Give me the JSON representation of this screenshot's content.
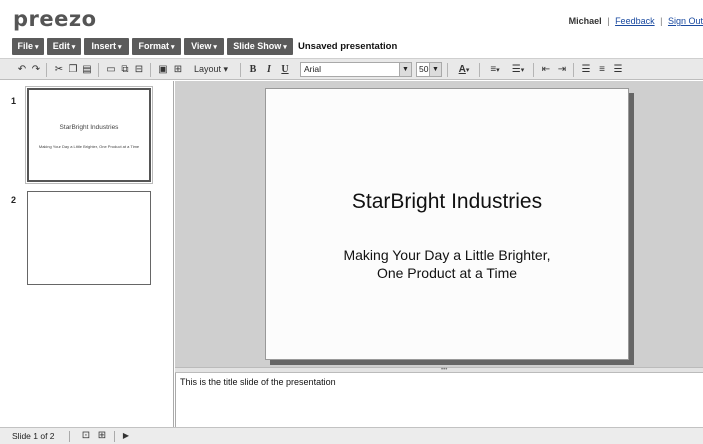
{
  "app": {
    "logo": "preezo"
  },
  "user": {
    "name": "Michael",
    "feedback": "Feedback",
    "signout": "Sign Out",
    "separator": "|"
  },
  "menu": {
    "items": [
      {
        "label": "File"
      },
      {
        "label": "Edit"
      },
      {
        "label": "Insert"
      },
      {
        "label": "Format"
      },
      {
        "label": "View"
      },
      {
        "label": "Slide Show"
      }
    ],
    "doc_title": "Unsaved presentation"
  },
  "toolbar": {
    "layout_label": "Layout",
    "bold": "B",
    "italic": "I",
    "underline": "U",
    "font": "Arial",
    "size": "50",
    "font_color_label": "A"
  },
  "slides": [
    {
      "num": "1",
      "title": "StarBright Industries",
      "subtitle": "Making Your Day a Little Brighter, One Product at a Time"
    },
    {
      "num": "2",
      "title": "",
      "subtitle": ""
    }
  ],
  "current_slide": {
    "title": "StarBright Industries",
    "subtitle_line1": "Making Your Day a Little Brighter,",
    "subtitle_line2": "One Product at a Time"
  },
  "notes": {
    "text": "This is the title slide of the presentation"
  },
  "status": {
    "text": "Slide 1 of 2"
  }
}
